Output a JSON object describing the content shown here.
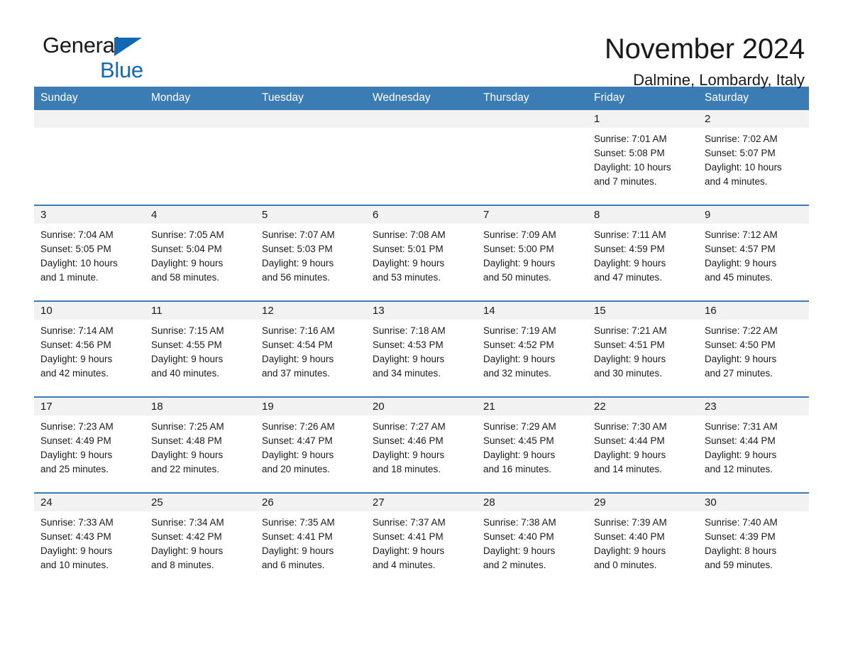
{
  "brand": {
    "name_part1": "General",
    "name_part2": "Blue",
    "mark": "triangle-logo-mark"
  },
  "header": {
    "title": "November 2024",
    "subtitle": "Dalmine, Lombardy, Italy"
  },
  "colors": {
    "header_blue": "#3b7cb5",
    "brand_blue": "#1268b3",
    "daynum_band": "#f2f2f2",
    "text": "#1a1a1a"
  },
  "weekday_headers": [
    "Sunday",
    "Monday",
    "Tuesday",
    "Wednesday",
    "Thursday",
    "Friday",
    "Saturday"
  ],
  "weeks": [
    [
      {
        "day": "",
        "sunrise": "",
        "sunset": "",
        "daylight_line1": "",
        "daylight_line2": ""
      },
      {
        "day": "",
        "sunrise": "",
        "sunset": "",
        "daylight_line1": "",
        "daylight_line2": ""
      },
      {
        "day": "",
        "sunrise": "",
        "sunset": "",
        "daylight_line1": "",
        "daylight_line2": ""
      },
      {
        "day": "",
        "sunrise": "",
        "sunset": "",
        "daylight_line1": "",
        "daylight_line2": ""
      },
      {
        "day": "",
        "sunrise": "",
        "sunset": "",
        "daylight_line1": "",
        "daylight_line2": ""
      },
      {
        "day": "1",
        "sunrise": "Sunrise: 7:01 AM",
        "sunset": "Sunset: 5:08 PM",
        "daylight_line1": "Daylight: 10 hours",
        "daylight_line2": "and 7 minutes."
      },
      {
        "day": "2",
        "sunrise": "Sunrise: 7:02 AM",
        "sunset": "Sunset: 5:07 PM",
        "daylight_line1": "Daylight: 10 hours",
        "daylight_line2": "and 4 minutes."
      }
    ],
    [
      {
        "day": "3",
        "sunrise": "Sunrise: 7:04 AM",
        "sunset": "Sunset: 5:05 PM",
        "daylight_line1": "Daylight: 10 hours",
        "daylight_line2": "and 1 minute."
      },
      {
        "day": "4",
        "sunrise": "Sunrise: 7:05 AM",
        "sunset": "Sunset: 5:04 PM",
        "daylight_line1": "Daylight: 9 hours",
        "daylight_line2": "and 58 minutes."
      },
      {
        "day": "5",
        "sunrise": "Sunrise: 7:07 AM",
        "sunset": "Sunset: 5:03 PM",
        "daylight_line1": "Daylight: 9 hours",
        "daylight_line2": "and 56 minutes."
      },
      {
        "day": "6",
        "sunrise": "Sunrise: 7:08 AM",
        "sunset": "Sunset: 5:01 PM",
        "daylight_line1": "Daylight: 9 hours",
        "daylight_line2": "and 53 minutes."
      },
      {
        "day": "7",
        "sunrise": "Sunrise: 7:09 AM",
        "sunset": "Sunset: 5:00 PM",
        "daylight_line1": "Daylight: 9 hours",
        "daylight_line2": "and 50 minutes."
      },
      {
        "day": "8",
        "sunrise": "Sunrise: 7:11 AM",
        "sunset": "Sunset: 4:59 PM",
        "daylight_line1": "Daylight: 9 hours",
        "daylight_line2": "and 47 minutes."
      },
      {
        "day": "9",
        "sunrise": "Sunrise: 7:12 AM",
        "sunset": "Sunset: 4:57 PM",
        "daylight_line1": "Daylight: 9 hours",
        "daylight_line2": "and 45 minutes."
      }
    ],
    [
      {
        "day": "10",
        "sunrise": "Sunrise: 7:14 AM",
        "sunset": "Sunset: 4:56 PM",
        "daylight_line1": "Daylight: 9 hours",
        "daylight_line2": "and 42 minutes."
      },
      {
        "day": "11",
        "sunrise": "Sunrise: 7:15 AM",
        "sunset": "Sunset: 4:55 PM",
        "daylight_line1": "Daylight: 9 hours",
        "daylight_line2": "and 40 minutes."
      },
      {
        "day": "12",
        "sunrise": "Sunrise: 7:16 AM",
        "sunset": "Sunset: 4:54 PM",
        "daylight_line1": "Daylight: 9 hours",
        "daylight_line2": "and 37 minutes."
      },
      {
        "day": "13",
        "sunrise": "Sunrise: 7:18 AM",
        "sunset": "Sunset: 4:53 PM",
        "daylight_line1": "Daylight: 9 hours",
        "daylight_line2": "and 34 minutes."
      },
      {
        "day": "14",
        "sunrise": "Sunrise: 7:19 AM",
        "sunset": "Sunset: 4:52 PM",
        "daylight_line1": "Daylight: 9 hours",
        "daylight_line2": "and 32 minutes."
      },
      {
        "day": "15",
        "sunrise": "Sunrise: 7:21 AM",
        "sunset": "Sunset: 4:51 PM",
        "daylight_line1": "Daylight: 9 hours",
        "daylight_line2": "and 30 minutes."
      },
      {
        "day": "16",
        "sunrise": "Sunrise: 7:22 AM",
        "sunset": "Sunset: 4:50 PM",
        "daylight_line1": "Daylight: 9 hours",
        "daylight_line2": "and 27 minutes."
      }
    ],
    [
      {
        "day": "17",
        "sunrise": "Sunrise: 7:23 AM",
        "sunset": "Sunset: 4:49 PM",
        "daylight_line1": "Daylight: 9 hours",
        "daylight_line2": "and 25 minutes."
      },
      {
        "day": "18",
        "sunrise": "Sunrise: 7:25 AM",
        "sunset": "Sunset: 4:48 PM",
        "daylight_line1": "Daylight: 9 hours",
        "daylight_line2": "and 22 minutes."
      },
      {
        "day": "19",
        "sunrise": "Sunrise: 7:26 AM",
        "sunset": "Sunset: 4:47 PM",
        "daylight_line1": "Daylight: 9 hours",
        "daylight_line2": "and 20 minutes."
      },
      {
        "day": "20",
        "sunrise": "Sunrise: 7:27 AM",
        "sunset": "Sunset: 4:46 PM",
        "daylight_line1": "Daylight: 9 hours",
        "daylight_line2": "and 18 minutes."
      },
      {
        "day": "21",
        "sunrise": "Sunrise: 7:29 AM",
        "sunset": "Sunset: 4:45 PM",
        "daylight_line1": "Daylight: 9 hours",
        "daylight_line2": "and 16 minutes."
      },
      {
        "day": "22",
        "sunrise": "Sunrise: 7:30 AM",
        "sunset": "Sunset: 4:44 PM",
        "daylight_line1": "Daylight: 9 hours",
        "daylight_line2": "and 14 minutes."
      },
      {
        "day": "23",
        "sunrise": "Sunrise: 7:31 AM",
        "sunset": "Sunset: 4:44 PM",
        "daylight_line1": "Daylight: 9 hours",
        "daylight_line2": "and 12 minutes."
      }
    ],
    [
      {
        "day": "24",
        "sunrise": "Sunrise: 7:33 AM",
        "sunset": "Sunset: 4:43 PM",
        "daylight_line1": "Daylight: 9 hours",
        "daylight_line2": "and 10 minutes."
      },
      {
        "day": "25",
        "sunrise": "Sunrise: 7:34 AM",
        "sunset": "Sunset: 4:42 PM",
        "daylight_line1": "Daylight: 9 hours",
        "daylight_line2": "and 8 minutes."
      },
      {
        "day": "26",
        "sunrise": "Sunrise: 7:35 AM",
        "sunset": "Sunset: 4:41 PM",
        "daylight_line1": "Daylight: 9 hours",
        "daylight_line2": "and 6 minutes."
      },
      {
        "day": "27",
        "sunrise": "Sunrise: 7:37 AM",
        "sunset": "Sunset: 4:41 PM",
        "daylight_line1": "Daylight: 9 hours",
        "daylight_line2": "and 4 minutes."
      },
      {
        "day": "28",
        "sunrise": "Sunrise: 7:38 AM",
        "sunset": "Sunset: 4:40 PM",
        "daylight_line1": "Daylight: 9 hours",
        "daylight_line2": "and 2 minutes."
      },
      {
        "day": "29",
        "sunrise": "Sunrise: 7:39 AM",
        "sunset": "Sunset: 4:40 PM",
        "daylight_line1": "Daylight: 9 hours",
        "daylight_line2": "and 0 minutes."
      },
      {
        "day": "30",
        "sunrise": "Sunrise: 7:40 AM",
        "sunset": "Sunset: 4:39 PM",
        "daylight_line1": "Daylight: 8 hours",
        "daylight_line2": "and 59 minutes."
      }
    ]
  ]
}
